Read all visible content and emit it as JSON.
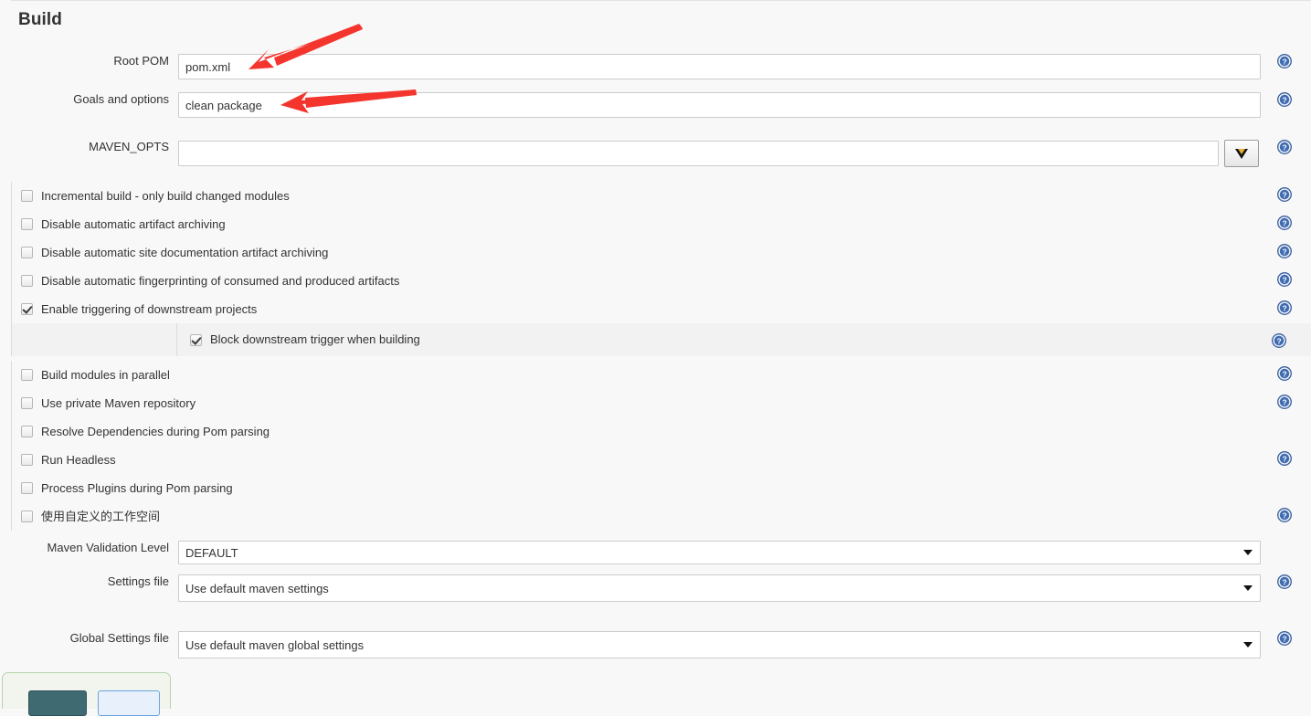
{
  "section": {
    "title": "Build"
  },
  "fields": {
    "root_pom": {
      "label": "Root POM",
      "value": "pom.xml",
      "placeholder": ""
    },
    "goals": {
      "label": "Goals and options",
      "value": "clean package",
      "placeholder": ""
    },
    "maven_opts": {
      "label": "MAVEN_OPTS",
      "value": "",
      "placeholder": ""
    }
  },
  "checkboxes_top": [
    {
      "label": "Incremental build - only build changed modules",
      "checked": false,
      "help": true
    },
    {
      "label": "Disable automatic artifact archiving",
      "checked": false,
      "help": true
    },
    {
      "label": "Disable automatic site documentation artifact archiving",
      "checked": false,
      "help": true
    },
    {
      "label": "Disable automatic fingerprinting of consumed and produced artifacts",
      "checked": false,
      "help": true
    },
    {
      "label": "Enable triggering of downstream projects",
      "checked": true,
      "help": true
    }
  ],
  "nested_checkbox": {
    "label": "Block downstream trigger when building",
    "checked": true,
    "help": true
  },
  "checkboxes_bottom": [
    {
      "label": "Build modules in parallel",
      "checked": false,
      "help": true
    },
    {
      "label": "Use private Maven repository",
      "checked": false,
      "help": true
    },
    {
      "label": "Resolve Dependencies during Pom parsing",
      "checked": false,
      "help": false
    },
    {
      "label": "Run Headless",
      "checked": false,
      "help": true
    },
    {
      "label": "Process Plugins during Pom parsing",
      "checked": false,
      "help": false
    },
    {
      "label": "使用自定义的工作空间",
      "checked": false,
      "help": true
    }
  ],
  "selects": {
    "validation_level": {
      "label": "Maven Validation Level",
      "value": "DEFAULT",
      "help": false
    },
    "settings_file": {
      "label": "Settings file",
      "value": "Use default maven settings",
      "help": true
    },
    "global_settings_file": {
      "label": "Global Settings file",
      "value": "Use default maven global settings",
      "help": true
    }
  },
  "icons": {
    "help": "help-question-circle-icon",
    "dropdown": "chevron-down-icon"
  },
  "colors": {
    "page_background": "#f8f8f8",
    "nested_row_background": "#f2f2f2",
    "help_icon": "#3a5f9e",
    "annotation_arrow": "#f4352e",
    "primary_button": "#3f6a72",
    "secondary_button": "#e8f1fb"
  },
  "annotations": [
    {
      "name": "arrow-to-root-pom",
      "points_to": "root_pom"
    },
    {
      "name": "arrow-to-goals",
      "points_to": "goals"
    }
  ]
}
